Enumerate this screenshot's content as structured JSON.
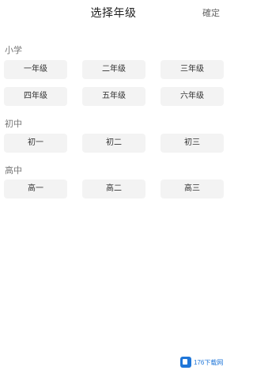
{
  "header": {
    "title": "选择年级",
    "confirm_label": "確定"
  },
  "sections": [
    {
      "title": "小学",
      "grades": [
        "一年级",
        "二年级",
        "三年级",
        "四年级",
        "五年级",
        "六年级"
      ]
    },
    {
      "title": "初中",
      "grades": [
        "初一",
        "初二",
        "初三"
      ]
    },
    {
      "title": "高中",
      "grades": [
        "高一",
        "高二",
        "高三"
      ]
    }
  ],
  "watermark": {
    "text": "176下载网",
    "icon": "site-logo-icon",
    "color": "#1f76d8"
  },
  "colors": {
    "chip_background": "#f3f3f3",
    "text": "#333333"
  }
}
